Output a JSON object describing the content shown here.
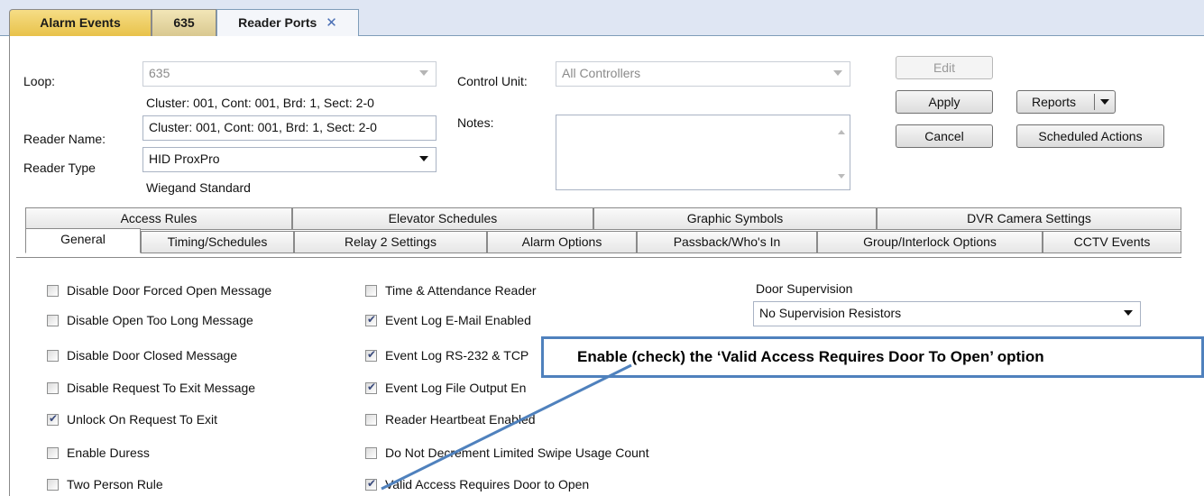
{
  "tabs": [
    "Alarm Events",
    "635",
    "Reader Ports"
  ],
  "form": {
    "loop_label": "Loop:",
    "loop_value": "635",
    "loop_info": "Cluster: 001, Cont: 001, Brd: 1, Sect: 2-0",
    "reader_name_label": "Reader Name:",
    "reader_name_value": "Cluster: 001, Cont: 001, Brd: 1, Sect: 2-0",
    "reader_type_label": "Reader Type",
    "reader_type_value": "HID ProxPro",
    "reader_type_info": "Wiegand Standard",
    "control_unit_label": "Control Unit:",
    "control_unit_value": "All Controllers",
    "notes_label": "Notes:",
    "notes_value": ""
  },
  "buttons": {
    "edit": "Edit",
    "apply": "Apply",
    "cancel": "Cancel",
    "reports": "Reports",
    "scheduled_actions": "Scheduled Actions"
  },
  "inner_tabs_row1": [
    "Access Rules",
    "Elevator Schedules",
    "Graphic Symbols",
    "DVR Camera Settings"
  ],
  "inner_tabs_row2": [
    "General",
    "Timing/Schedules",
    "Relay 2 Settings",
    "Alarm Options",
    "Passback/Who's In",
    "Group/Interlock Options",
    "CCTV Events"
  ],
  "options_col1": [
    {
      "label": "Disable Door Forced Open Message",
      "checked": false
    },
    {
      "label": "Disable Open Too Long Message",
      "checked": false
    },
    {
      "label": "Disable Door Closed Message",
      "checked": false
    },
    {
      "label": "Disable Request To Exit Message",
      "checked": false
    },
    {
      "label": "Unlock On Request To Exit",
      "checked": true
    },
    {
      "label": "Enable Duress",
      "checked": false
    },
    {
      "label": "Two Person Rule",
      "checked": false
    }
  ],
  "options_col2": [
    {
      "label": "Time & Attendance Reader",
      "checked": false
    },
    {
      "label": "Event Log E-Mail Enabled",
      "checked": true
    },
    {
      "label": "Event Log RS-232 & TCP",
      "checked": true
    },
    {
      "label": "Event Log File Output En",
      "checked": true
    },
    {
      "label": "Reader Heartbeat Enabled",
      "checked": false
    },
    {
      "label": "Do Not Decrement Limited Swipe Usage Count",
      "checked": false
    },
    {
      "label": "Valid Access Requires Door to Open",
      "checked": true
    }
  ],
  "door_supervision": {
    "label": "Door Supervision",
    "value": "No Supervision Resistors"
  },
  "callout": "Enable (check) the ‘Valid Access Requires Door To Open’ option",
  "colors": {
    "callout_border": "#4f81bd",
    "active_tab_bg": "#f4f6fa"
  }
}
